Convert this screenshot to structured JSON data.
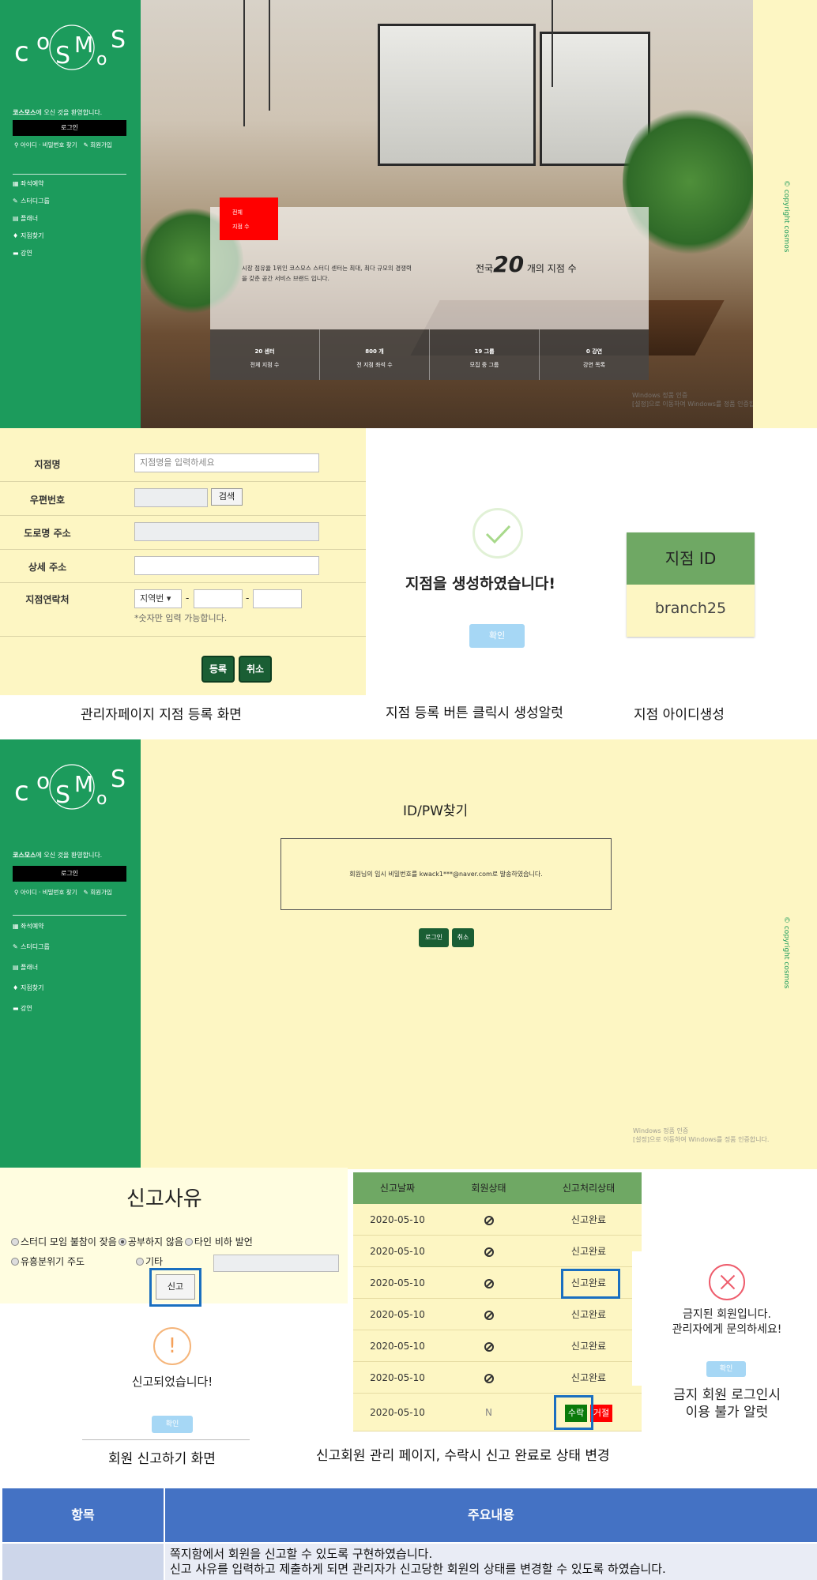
{
  "brand": {
    "logo_text": "COSMOS",
    "welcome_name": "코스모스",
    "welcome_rest": "에 오신 것을 환영합니다.",
    "login_label": "로그인",
    "find_id_pw": "아이디 · 비밀번호 찾기",
    "signup": "회원가입"
  },
  "side_menu": [
    {
      "icon": "calendar-icon",
      "label": "좌석예약"
    },
    {
      "icon": "pencil-icon",
      "label": "스터디그룹"
    },
    {
      "icon": "planner-icon",
      "label": "플래너"
    },
    {
      "icon": "pin-icon",
      "label": "지점찾기"
    },
    {
      "icon": "lecture-icon",
      "label": "강연"
    }
  ],
  "hero": {
    "badge_line1": "전체",
    "badge_line2": "지점 수",
    "intro": "시장 점유율 1위인 코스모스 스터디 센터는 최대, 최다 규모의 경쟁력을 갖춘 공간 서비스 브랜드 입니다.",
    "total_prefix": "전국",
    "total_number": "20",
    "total_suffix": "개의 지점 수",
    "stats": [
      {
        "value": "20 센터",
        "label": "전체 지점 수"
      },
      {
        "value": "800 개",
        "label": "전 지점 좌석 수"
      },
      {
        "value": "19 그룹",
        "label": "모집 중 그룹"
      },
      {
        "value": "0 강연",
        "label": "강연 목록"
      }
    ],
    "copyright": "© copyright cosmos",
    "windows_line1": "Windows 정품 인증",
    "windows_line2": "[설정]으로 이동하여 Windows를 정품 인증합니다."
  },
  "branch_form": {
    "rows": [
      {
        "label": "지점명",
        "placeholder": "지점명을 입력하세요"
      },
      {
        "label": "우편번호",
        "search_label": "검색"
      },
      {
        "label": "도로명 주소"
      },
      {
        "label": "상세 주소"
      },
      {
        "label": "지점연락처",
        "select_value": "지역번",
        "dash": "-",
        "note": "*숫자만 입력 가능합니다."
      }
    ],
    "register_label": "등록",
    "cancel_label": "취소",
    "caption": "관리자페이지 지점 등록 화면"
  },
  "create_alert": {
    "message": "지점을 생성하였습니다!",
    "ok_label": "확인",
    "caption": "지점 등록 버튼 클릭시 생성알럿"
  },
  "branch_id": {
    "header": "지점 ID",
    "value": "branch25",
    "caption": "지점 아이디생성"
  },
  "find_page": {
    "title": "ID/PW찾기",
    "message": "회원님의 임시 비밀번호를 kwack1***@naver.com로 발송하였습니다.",
    "login_label": "로그인",
    "cancel_label": "취소"
  },
  "report_form": {
    "title": "신고사유",
    "options": [
      "스터디 모임 불참이 잦음",
      "공부하지 않음",
      "타인 비하 발언",
      "유흥분위기 주도",
      "기타"
    ],
    "submit_label": "신고",
    "done_message": "신고되었습니다!",
    "ok_label": "확인",
    "caption": "회원 신고하기 화면"
  },
  "report_table": {
    "headers": [
      "신고날짜",
      "회원상태",
      "신고처리상태"
    ],
    "rows": [
      {
        "date": "2020-05-10",
        "status": "ban",
        "result": "신고완료"
      },
      {
        "date": "2020-05-10",
        "status": "ban",
        "result": "신고완료"
      },
      {
        "date": "2020-05-10",
        "status": "ban",
        "result": "신고완료"
      },
      {
        "date": "2020-05-10",
        "status": "ban",
        "result": "신고완료"
      },
      {
        "date": "2020-05-10",
        "status": "ban",
        "result": "신고완료"
      },
      {
        "date": "2020-05-10",
        "status": "ban",
        "result": "신고완료"
      },
      {
        "date": "2020-05-10",
        "status": "N",
        "result": ""
      }
    ],
    "accept_label": "수락",
    "reject_label": "거절",
    "caption": "신고회원 관리 페이지, 수락시 신고 완료로 상태 변경"
  },
  "banned_alert": {
    "line1": "금지된 회원입니다.",
    "line2": "관리자에게 문의하세요!",
    "ok_label": "확인",
    "caption_line1": "금지 회원 로그인시",
    "caption_line2": "이용 불가 알럿"
  },
  "summary_table": {
    "col1": "항목",
    "col2": "주요내용",
    "line1": "쪽지함에서 회원을 신고할 수 있도록 구현하였습니다.",
    "line2": "신고 사유를 입력하고 제출하게 되면 관리자가 신고당한 회원의 상태를 변경할 수 있도록 하였습니다."
  },
  "colors": {
    "sidebar_green": "#1c9b5c",
    "cream": "#fdf6c3",
    "table_green": "#6fa864",
    "header_blue": "#4472c4",
    "accept_green": "#0a7a0a",
    "reject_red": "#ff0000"
  }
}
